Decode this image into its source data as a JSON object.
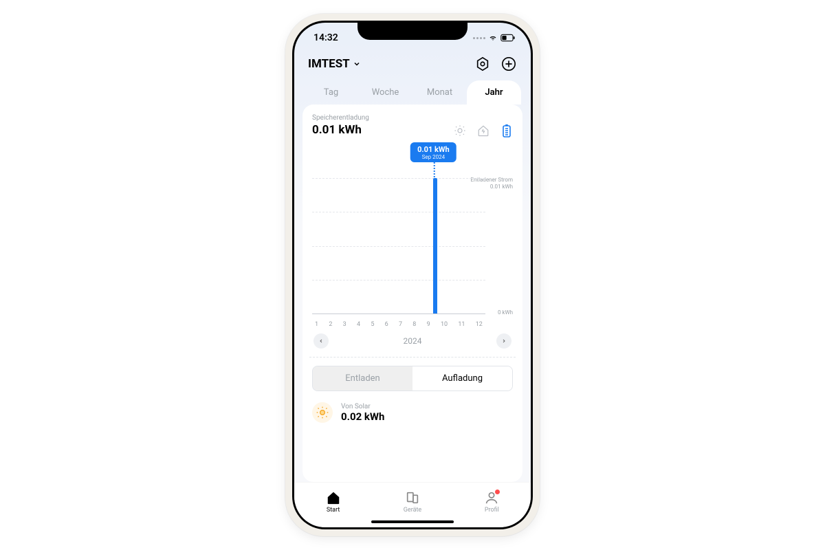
{
  "status": {
    "time": "14:32"
  },
  "header": {
    "site_name": "IMTEST"
  },
  "period_tabs": {
    "items": [
      "Tag",
      "Woche",
      "Monat",
      "Jahr"
    ],
    "active_index": 3
  },
  "metric": {
    "label": "Speicherentladung",
    "value": "0.01 kWh"
  },
  "chart_data": {
    "type": "bar",
    "categories": [
      "1",
      "2",
      "3",
      "4",
      "5",
      "6",
      "7",
      "8",
      "9",
      "10",
      "11",
      "12"
    ],
    "values": [
      0,
      0,
      0,
      0,
      0,
      0,
      0,
      0,
      0.01,
      0,
      0,
      0
    ],
    "ylim": [
      0,
      0.01
    ],
    "ylabel_right_top_title": "Entladener Strom",
    "ylabel_right_top_value": "0.01 kWh",
    "ylabel_right_bottom": "0 kWh",
    "tooltip": {
      "value": "0.01 kWh",
      "date": "Sep 2024",
      "month_index": 8
    }
  },
  "year_nav": {
    "year": "2024"
  },
  "dc_toggle": {
    "discharge": "Entladen",
    "charge": "Aufladung",
    "active": "charge"
  },
  "solar": {
    "label": "Von Solar",
    "value": "0.02 kWh"
  },
  "bottom_nav": {
    "items": [
      {
        "label": "Start"
      },
      {
        "label": "Geräte"
      },
      {
        "label": "Profil"
      }
    ],
    "active_index": 0,
    "badge_index": 2
  }
}
